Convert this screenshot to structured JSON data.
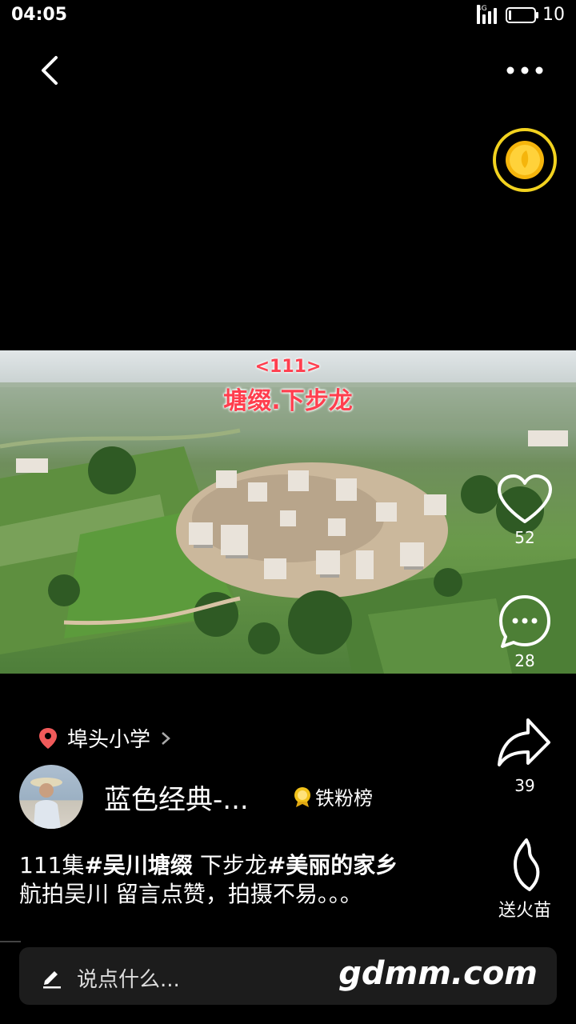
{
  "status_bar": {
    "time": "04:05",
    "network": "4G",
    "battery": "10",
    "battery_level": 0.1
  },
  "video": {
    "episode_tag": "<111>",
    "location_title": "塘缀.下步龙"
  },
  "actions": {
    "like_count": "52",
    "comment_count": "28",
    "share_count": "39",
    "gift_label": "送火苗"
  },
  "location": {
    "label": "埠头小学"
  },
  "author": {
    "name": "蓝色经典-...",
    "fan_rank_label": "铁粉榜"
  },
  "description": {
    "part1": "111集",
    "tag1": "#吴川塘缀",
    "part2": " 下步龙",
    "tag2": "#美丽的家乡",
    "line2": "航拍吴川 留言点赞，拍摄不易。。。"
  },
  "comment_bar": {
    "placeholder": "说点什么...",
    "watermark": "gdmm.com"
  },
  "colors": {
    "background": "#000000",
    "coin_ring": "#f2d21f",
    "location_pin": "#f05a5a",
    "overlay_title": "#ff3e4e"
  }
}
